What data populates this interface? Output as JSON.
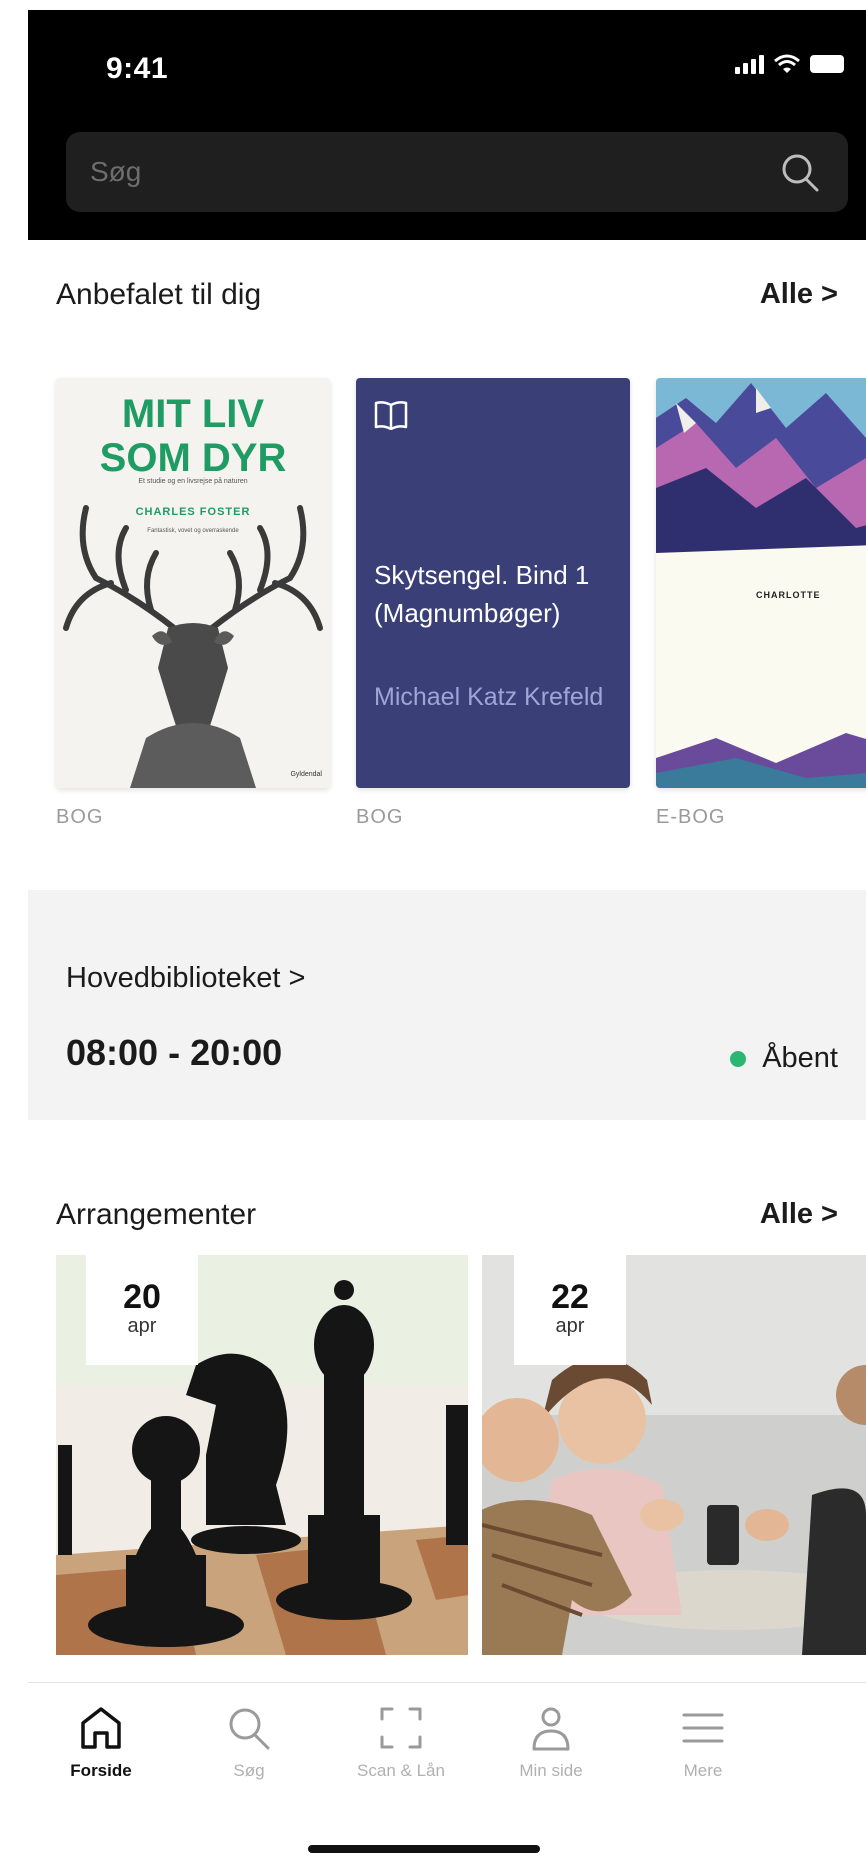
{
  "status_bar": {
    "time": "9:41"
  },
  "search": {
    "placeholder": "Søg"
  },
  "recommended": {
    "title": "Anbefalet til dig",
    "see_all": "Alle >",
    "books": [
      {
        "cover_title_line1": "MIT LIV",
        "cover_title_line2": "SOM DYR",
        "cover_subtitle": "Et studie og en livsrejse på naturen",
        "cover_author": "CHARLES FOSTER",
        "cover_quote": "Fantastisk, vovet og overraskende",
        "cover_publisher": "Gyldendal",
        "type": "BOG"
      },
      {
        "title": "Skytsengel. Bind 1 (Magnumbøger)",
        "author": "Michael Katz Krefeld",
        "type": "BOG"
      },
      {
        "cover_author": "CHARLOTTE",
        "type": "E-BOG"
      }
    ]
  },
  "library": {
    "name": "Hovedbiblioteket >",
    "hours": "08:00 - 20:00",
    "status": "Åbent",
    "status_color": "#2bb673"
  },
  "events": {
    "title": "Arrangementer",
    "see_all": "Alle >",
    "items": [
      {
        "day": "20",
        "month": "apr"
      },
      {
        "day": "22",
        "month": "apr"
      }
    ]
  },
  "nav": {
    "items": [
      {
        "label": "Forside",
        "icon": "home-icon",
        "active": true
      },
      {
        "label": "Søg",
        "icon": "search-icon",
        "active": false
      },
      {
        "label": "Scan & Lån",
        "icon": "scan-icon",
        "active": false
      },
      {
        "label": "Min side",
        "icon": "person-icon",
        "active": false
      },
      {
        "label": "Mere",
        "icon": "menu-icon",
        "active": false
      }
    ]
  }
}
